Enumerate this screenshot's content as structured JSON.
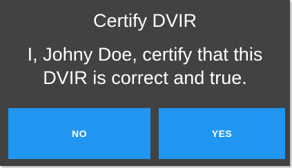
{
  "dialog": {
    "title": "Certify DVIR",
    "message": "I, Johny Doe, certify that this DVIR is correct and true.",
    "no_label": "NO",
    "yes_label": "YES"
  },
  "colors": {
    "dialog_background": "#424242",
    "button_background": "#2196f3",
    "text": "#ffffff"
  }
}
